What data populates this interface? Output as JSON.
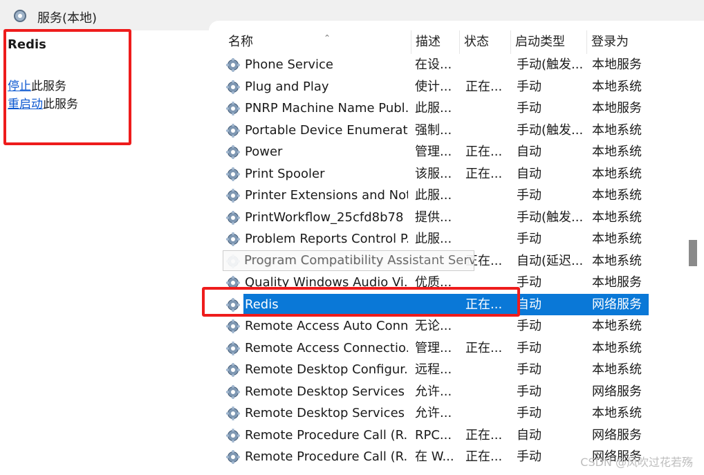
{
  "window": {
    "title": "服务(本地)",
    "icon": "services-gear-icon"
  },
  "left_pane": {
    "service_name": "Redis",
    "actions": [
      {
        "link": "停止",
        "suffix": "此服务"
      },
      {
        "link": "重启动",
        "suffix": "此服务"
      }
    ]
  },
  "columns": {
    "name": "名称",
    "desc": "描述",
    "status": "状态",
    "startup": "启动类型",
    "logon": "登录为"
  },
  "rows": [
    {
      "name": "Phone Service",
      "desc": "在设...",
      "status": "",
      "startup": "手动(触发...",
      "logon": "本地服务"
    },
    {
      "name": "Plug and Play",
      "desc": "使计...",
      "status": "正在...",
      "startup": "手动",
      "logon": "本地系统"
    },
    {
      "name": "PNRP Machine Name Publ...",
      "desc": "此服...",
      "status": "",
      "startup": "手动",
      "logon": "本地服务"
    },
    {
      "name": "Portable Device Enumerat...",
      "desc": "强制...",
      "status": "",
      "startup": "手动(触发...",
      "logon": "本地系统"
    },
    {
      "name": "Power",
      "desc": "管理...",
      "status": "正在...",
      "startup": "自动",
      "logon": "本地系统"
    },
    {
      "name": "Print Spooler",
      "desc": "该服...",
      "status": "正在...",
      "startup": "自动",
      "logon": "本地系统"
    },
    {
      "name": "Printer Extensions and Noti...",
      "desc": "此服...",
      "status": "",
      "startup": "手动",
      "logon": "本地系统"
    },
    {
      "name": "PrintWorkflow_25cfd8b78",
      "desc": "提供...",
      "status": "",
      "startup": "手动(触发...",
      "logon": "本地系统"
    },
    {
      "name": "Problem Reports Control P...",
      "desc": "此服...",
      "status": "",
      "startup": "手动",
      "logon": "本地系统"
    },
    {
      "name": "Program Compatibility Assi...",
      "desc": "",
      "status": "正在...",
      "startup": "自动(延迟...",
      "logon": "本地系统"
    },
    {
      "name": "Quality Windows Audio Vi...",
      "desc": "优质...",
      "status": "",
      "startup": "手动",
      "logon": "本地服务"
    },
    {
      "name": "Redis",
      "desc": "",
      "status": "正在...",
      "startup": "自动",
      "logon": "网络服务",
      "selected": true
    },
    {
      "name": "Remote Access Auto Conn...",
      "desc": "无论...",
      "status": "",
      "startup": "手动",
      "logon": "本地系统"
    },
    {
      "name": "Remote Access Connectio...",
      "desc": "管理...",
      "status": "正在...",
      "startup": "手动",
      "logon": "本地系统"
    },
    {
      "name": "Remote Desktop Configur...",
      "desc": "远程...",
      "status": "",
      "startup": "手动",
      "logon": "本地系统"
    },
    {
      "name": "Remote Desktop Services",
      "desc": "允许...",
      "status": "",
      "startup": "手动",
      "logon": "网络服务"
    },
    {
      "name": "Remote Desktop Services ...",
      "desc": "允许...",
      "status": "",
      "startup": "手动",
      "logon": "本地系统"
    },
    {
      "name": "Remote Procedure Call (R...",
      "desc": "RPC...",
      "status": "正在...",
      "startup": "自动",
      "logon": "网络服务"
    },
    {
      "name": "Remote Procedure Call (R...",
      "desc": "在 W...",
      "status": "正在...",
      "startup": "手动",
      "logon": "网络服务"
    }
  ],
  "tooltip": {
    "text": "Program Compatibility Assistant Service"
  },
  "watermark": "CSDN @风吹过花若殇",
  "colors": {
    "selection": "#0a78d7",
    "highlight_box": "#ee1c1c",
    "link": "#0b57d0"
  }
}
